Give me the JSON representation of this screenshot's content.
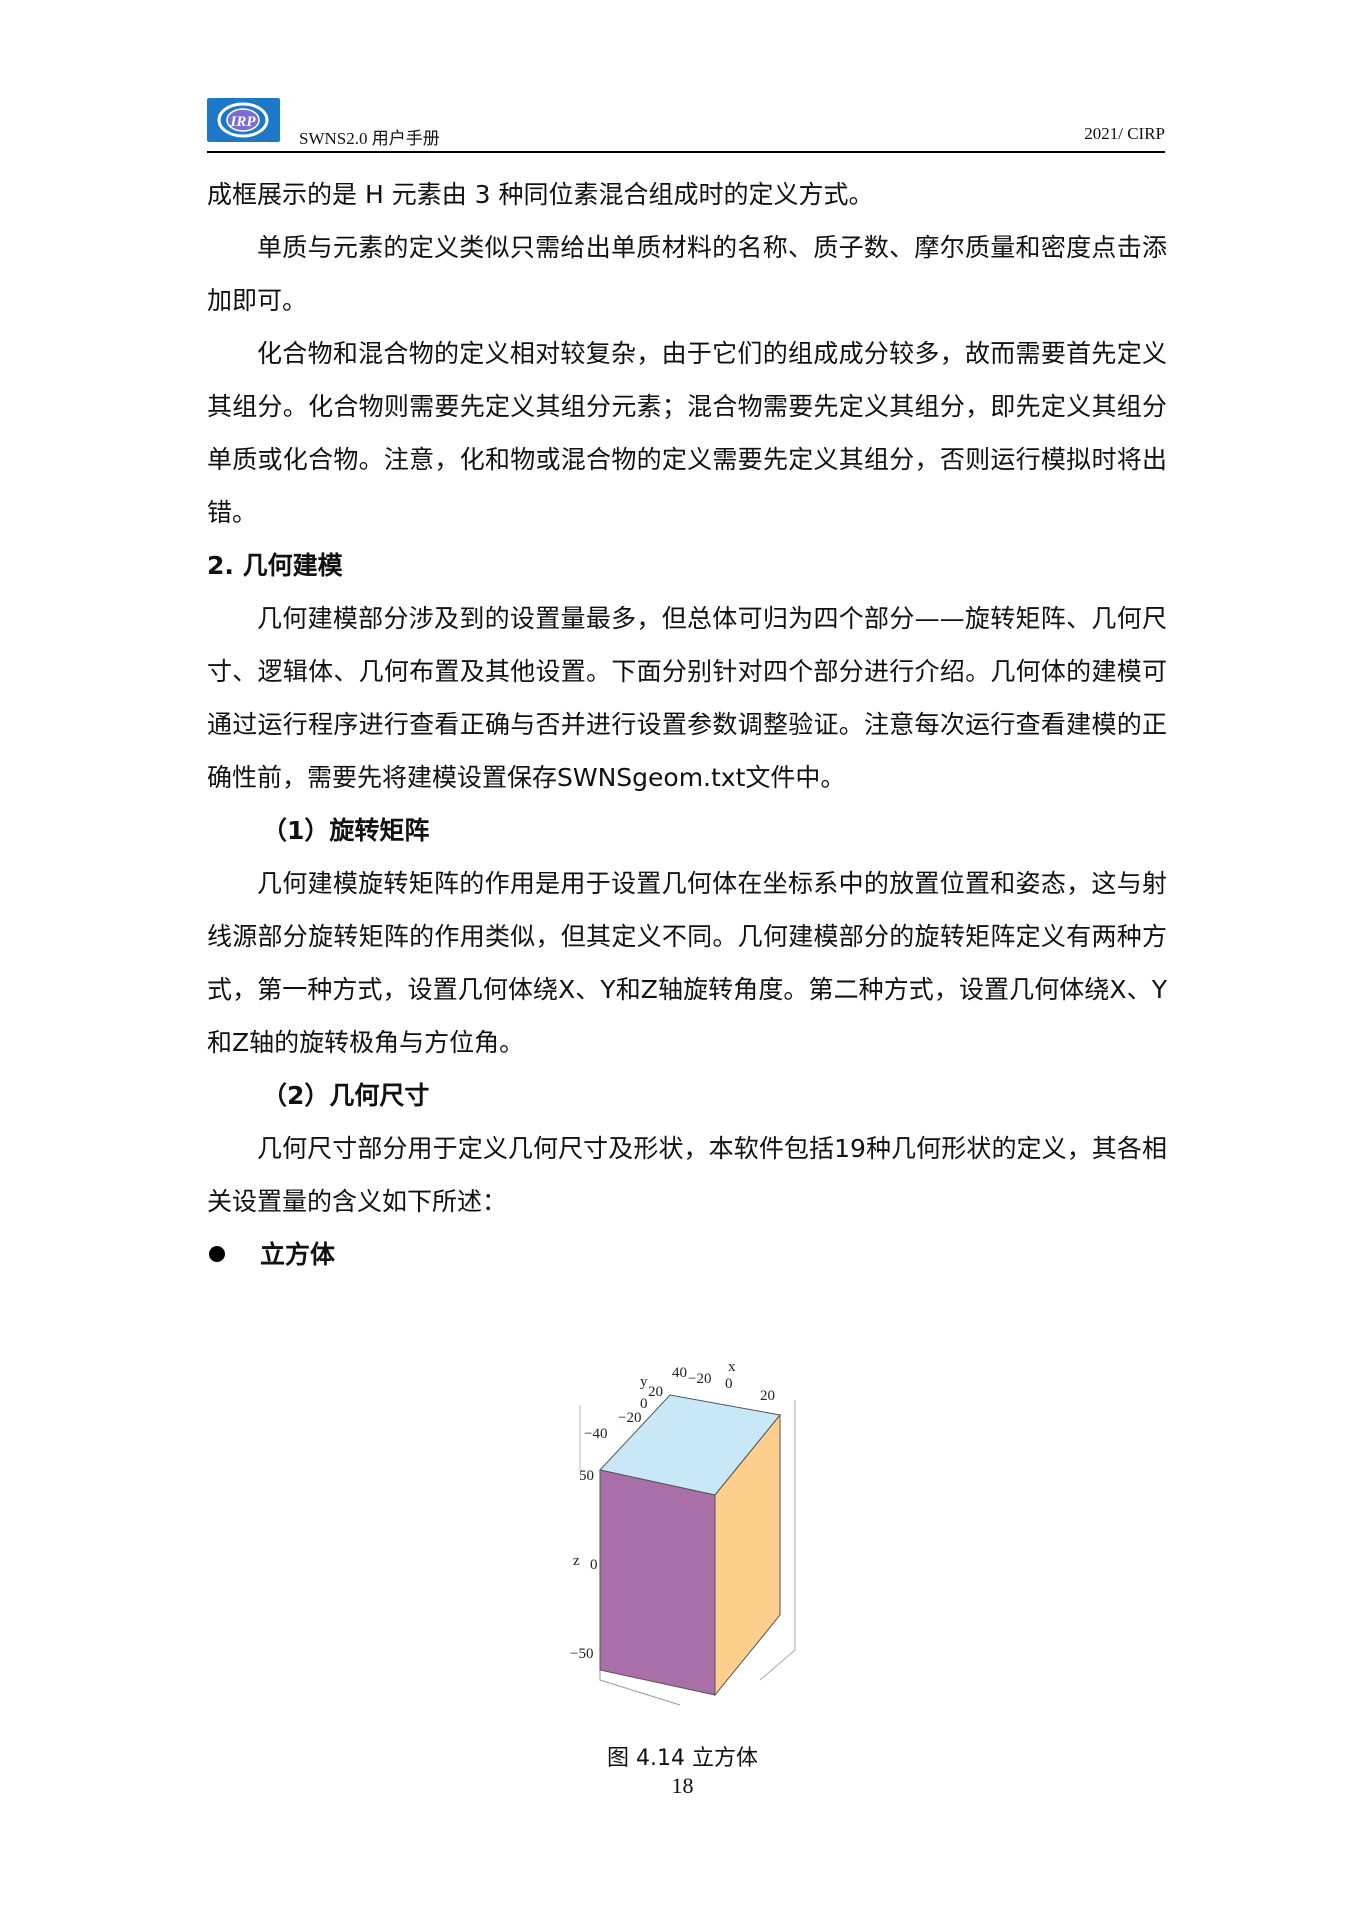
{
  "header": {
    "logo_text": "IRP",
    "left_text": "SWNS2.0  用户手册",
    "right_text": "2021/ CIRP"
  },
  "content": {
    "p1": "成框展示的是 H 元素由 3 种同位素混合组成时的定义方式。",
    "p2": "单质与元素的定义类似只需给出单质材料的名称、质子数、摩尔质量和密度点击添加即可。",
    "p3": "化合物和混合物的定义相对较复杂，由于它们的组成成分较多，故而需要首先定义其组分。化合物则需要先定义其组分元素；混合物需要先定义其组分，即先定义其组分单质或化合物。注意，化和物或混合物的定义需要先定义其组分，否则运行模拟时将出错。",
    "h2_geom": "2. 几何建模",
    "p4": "几何建模部分涉及到的设置量最多，但总体可归为四个部分——旋转矩阵、几何尺寸、逻辑体、几何布置及其他设置。下面分别针对四个部分进行介绍。几何体的建模可通过运行程序进行查看正确与否并进行设置参数调整验证。注意每次运行查看建模的正确性前，需要先将建模设置保存SWNSgeom.txt文件中。",
    "h3_rot": "（1）旋转矩阵",
    "p5": "几何建模旋转矩阵的作用是用于设置几何体在坐标系中的放置位置和姿态，这与射线源部分旋转矩阵的作用类似，但其定义不同。几何建模部分的旋转矩阵定义有两种方式，第一种方式，设置几何体绕X、Y和Z轴旋转角度。第二种方式，设置几何体绕X、Y和Z轴的旋转极角与方位角。",
    "h3_size": "（2）几何尺寸",
    "p6": "几何尺寸部分用于定义几何尺寸及形状，本软件包括19种几何形状的定义，其各相关设置量的含义如下所述：",
    "bullet_cube": "立方体"
  },
  "figure": {
    "x_label": "x",
    "x_ticks": [
      "40",
      "−20",
      "0",
      "20"
    ],
    "y_label": "y",
    "y_ticks": [
      "20",
      "0",
      "−20",
      "−40"
    ],
    "z_label": "z",
    "z_ticks": [
      "50",
      "0",
      "−50"
    ],
    "colors": {
      "top_face": "#c8e8f8",
      "front_face": "#a86fa8",
      "side_face": "#fcd08c",
      "edge": "#555555"
    },
    "caption": "图 4.14 立方体"
  },
  "page_number": "18"
}
